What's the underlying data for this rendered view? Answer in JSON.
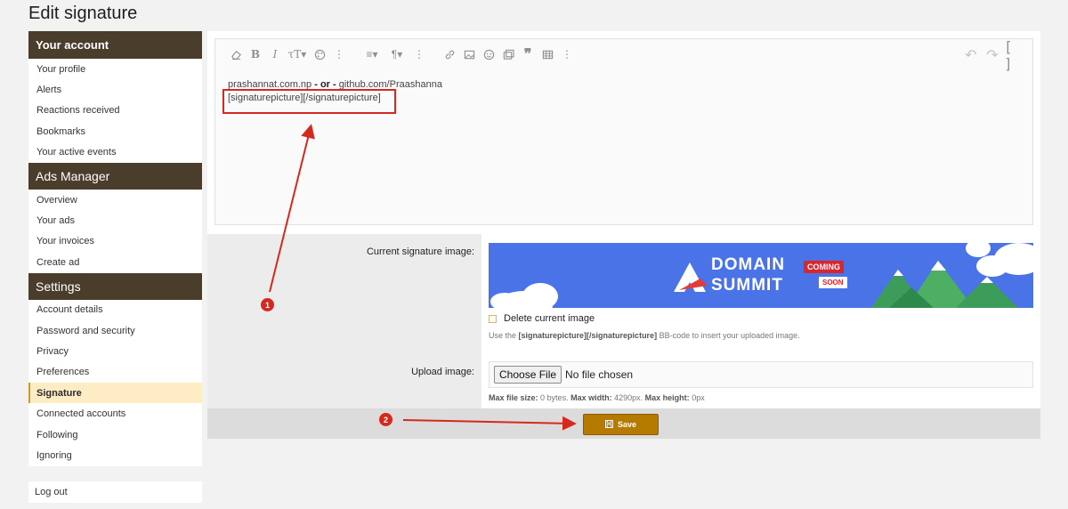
{
  "page": {
    "title": "Edit signature"
  },
  "sidebar": {
    "sections": [
      {
        "heading": "Your account",
        "items": [
          "Your profile",
          "Alerts",
          "Reactions received",
          "Bookmarks",
          "Your active events"
        ]
      },
      {
        "heading": "Ads Manager",
        "items": [
          "Overview",
          "Your ads",
          "Your invoices",
          "Create ad"
        ]
      },
      {
        "heading": "Settings",
        "items": [
          "Account details",
          "Password and security",
          "Privacy",
          "Preferences",
          "Signature",
          "Connected accounts",
          "Following",
          "Ignoring"
        ]
      }
    ],
    "active_item": "Signature",
    "logout": "Log out"
  },
  "editor": {
    "line1_part1": "prashannat.com.np",
    "line1_or": "- or -",
    "line1_part2": "github.com/Praashanna",
    "line2": "[signaturepicture][/signaturepicture]"
  },
  "form": {
    "current_image_label": "Current signature image:",
    "banner": {
      "text1": "DOMAIN",
      "text2": "SUMMIT",
      "badge1": "COMING",
      "badge2": "SOON"
    },
    "delete_label": "Delete current image",
    "hint_pre": "Use the",
    "hint_code": "[signaturepicture][/signaturepicture]",
    "hint_post": "BB-code to insert your uploaded image.",
    "upload_label": "Upload image:",
    "choose_file": "Choose File",
    "no_file": "No file chosen",
    "limits": {
      "size_label": "Max file size:",
      "size_value": "0 bytes.",
      "width_label": "Max width:",
      "width_value": "4290px.",
      "height_label": "Max height:",
      "height_value": "0px"
    },
    "save_label": "Save"
  },
  "annotations": {
    "marker1": "1",
    "marker2": "2",
    "color": "#d42a1e"
  },
  "colors": {
    "sidebar_heading": "#4b3d2c",
    "save_button": "#b57a00",
    "active_item_bg": "#fdecc4",
    "banner_bg": "#4a73e8"
  }
}
